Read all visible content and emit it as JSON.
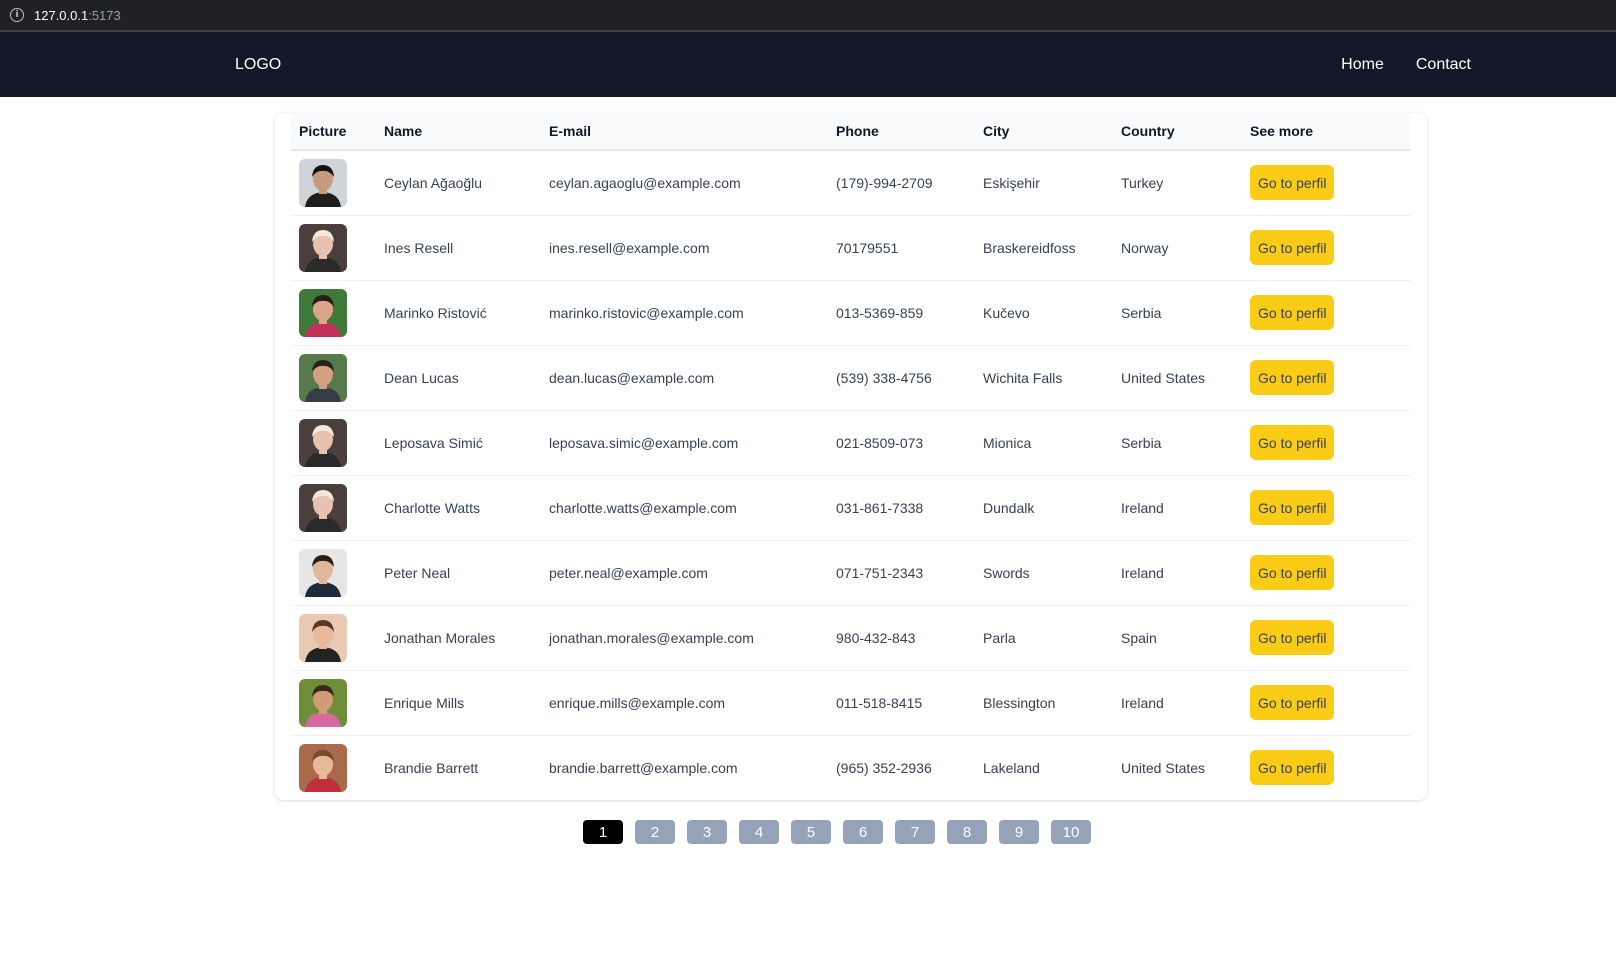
{
  "browser": {
    "url_host": "127.0.0.1",
    "url_port": ":5173"
  },
  "nav": {
    "logo": "LOGO",
    "links": [
      "Home",
      "Contact"
    ]
  },
  "table": {
    "headers": [
      "Picture",
      "Name",
      "E-mail",
      "Phone",
      "City",
      "Country",
      "See more"
    ],
    "button_label": "Go to perfil",
    "rows": [
      {
        "name": "Ceylan Ağaoğlu",
        "email": "ceylan.agaoglu@example.com",
        "phone": "(179)-994-2709",
        "city": "Eskişehir",
        "country": "Turkey",
        "avatar_color": "#cfd4d8",
        "skin": "#c69c80",
        "hair": "#111111",
        "shirt": "#1e1e1e"
      },
      {
        "name": "Ines Resell",
        "email": "ines.resell@example.com",
        "phone": "70179551",
        "city": "Braskereidfoss",
        "country": "Norway",
        "avatar_color": "#4a3f3c",
        "skin": "#e8c2b0",
        "hair": "#f1e9dc",
        "shirt": "#2a2a2a"
      },
      {
        "name": "Marinko Ristović",
        "email": "marinko.ristovic@example.com",
        "phone": "013-5369-859",
        "city": "Kučevo",
        "country": "Serbia",
        "avatar_color": "#3f7a3a",
        "skin": "#d9a488",
        "hair": "#2a1d14",
        "shirt": "#c0305a"
      },
      {
        "name": "Dean Lucas",
        "email": "dean.lucas@example.com",
        "phone": "(539) 338-4756",
        "city": "Wichita Falls",
        "country": "United States",
        "avatar_color": "#577a4c",
        "skin": "#d2a080",
        "hair": "#2b2118",
        "shirt": "#343c46"
      },
      {
        "name": "Leposava Simić",
        "email": "leposava.simic@example.com",
        "phone": "021-8509-073",
        "city": "Mionica",
        "country": "Serbia",
        "avatar_color": "#4a3f3c",
        "skin": "#e8c2b0",
        "hair": "#f1e9dc",
        "shirt": "#2a2a2a"
      },
      {
        "name": "Charlotte Watts",
        "email": "charlotte.watts@example.com",
        "phone": "031-861-7338",
        "city": "Dundalk",
        "country": "Ireland",
        "avatar_color": "#4a3f3c",
        "skin": "#e8c2b0",
        "hair": "#f1e9dc",
        "shirt": "#2a2a2a"
      },
      {
        "name": "Peter Neal",
        "email": "peter.neal@example.com",
        "phone": "071-751-2343",
        "city": "Swords",
        "country": "Ireland",
        "avatar_color": "#e6e6e6",
        "skin": "#e0b79a",
        "hair": "#2a1d14",
        "shirt": "#1f2a3a"
      },
      {
        "name": "Jonathan Morales",
        "email": "jonathan.morales@example.com",
        "phone": "980-432-843",
        "city": "Parla",
        "country": "Spain",
        "avatar_color": "#e9c9b4",
        "skin": "#eab89c",
        "hair": "#5a3a24",
        "shirt": "#222222"
      },
      {
        "name": "Enrique Mills",
        "email": "enrique.mills@example.com",
        "phone": "011-518-8415",
        "city": "Blessington",
        "country": "Ireland",
        "avatar_color": "#6e8e3a",
        "skin": "#d39a78",
        "hair": "#3a2a1c",
        "shirt": "#d66aa0"
      },
      {
        "name": "Brandie Barrett",
        "email": "brandie.barrett@example.com",
        "phone": "(965) 352-2936",
        "city": "Lakeland",
        "country": "United States",
        "avatar_color": "#a86a4a",
        "skin": "#e8b89a",
        "hair": "#7a4a2a",
        "shirt": "#c0303a"
      }
    ]
  },
  "pagination": {
    "pages": [
      "1",
      "2",
      "3",
      "4",
      "5",
      "6",
      "7",
      "8",
      "9",
      "10"
    ],
    "active": "1"
  },
  "colors": {
    "navbar": "#111827",
    "button": "#facc15",
    "page_inactive": "#94a3b8",
    "page_active": "#000000"
  }
}
